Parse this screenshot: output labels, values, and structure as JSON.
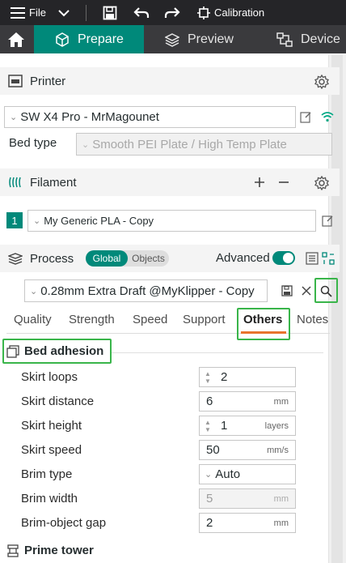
{
  "titlebar": {
    "file_label": "File",
    "calibration_label": "Calibration"
  },
  "tabs": [
    {
      "label": "Prepare"
    },
    {
      "label": "Preview"
    },
    {
      "label": "Device"
    }
  ],
  "printer": {
    "section_label": "Printer",
    "printer_name": "SW X4 Pro - MrMagounet",
    "bed_type_label": "Bed type",
    "bed_type_value": "Smooth PEI Plate / High Temp Plate"
  },
  "filament": {
    "section_label": "Filament",
    "slot_number": "1",
    "value": "My Generic PLA - Copy"
  },
  "process": {
    "section_label": "Process",
    "toggle_global": "Global",
    "toggle_objects": "Objects",
    "advanced_label": "Advanced",
    "preset_value": "0.28mm Extra Draft @MyKlipper - Copy"
  },
  "subtabs": [
    "Quality",
    "Strength",
    "Speed",
    "Support",
    "Others",
    "Notes"
  ],
  "bed_adhesion": {
    "group_label": "Bed adhesion",
    "params": [
      {
        "label": "Skirt loops",
        "value": "2",
        "unit": ""
      },
      {
        "label": "Skirt distance",
        "value": "6",
        "unit": "mm"
      },
      {
        "label": "Skirt height",
        "value": "1",
        "unit": "layers"
      },
      {
        "label": "Skirt speed",
        "value": "50",
        "unit": "mm/s"
      },
      {
        "label": "Brim type",
        "value": "Auto",
        "unit": ""
      },
      {
        "label": "Brim width",
        "value": "5",
        "unit": "mm"
      },
      {
        "label": "Brim-object gap",
        "value": "2",
        "unit": "mm"
      }
    ]
  },
  "prime_tower": {
    "group_label": "Prime tower"
  },
  "colors": {
    "accent": "#00897a",
    "highlight": "#39b54a",
    "underline": "#e8742d"
  }
}
